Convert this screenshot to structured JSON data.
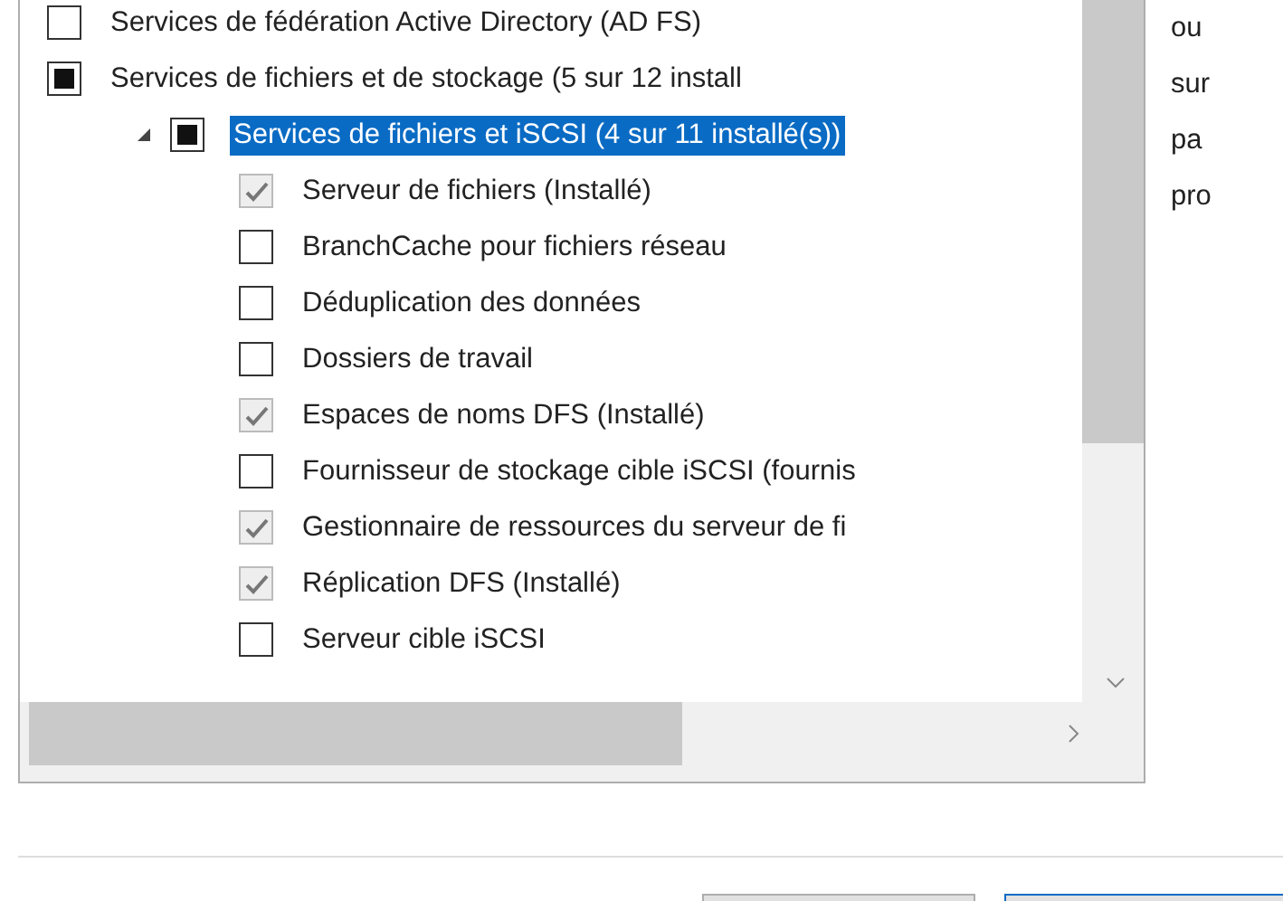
{
  "tree": {
    "items": [
      {
        "label": "Services de fédération Active Directory (AD FS)",
        "checked": false,
        "partial": false,
        "selected": false
      },
      {
        "label": "Services de fichiers et de stockage (5 sur 12 install",
        "checked": false,
        "partial": true,
        "selected": false,
        "children": [
          {
            "label": "Services de fichiers et iSCSI (4 sur 11 installé(s))",
            "checked": false,
            "partial": true,
            "selected": true,
            "expanded": true,
            "children": [
              {
                "label": "Serveur de fichiers (Installé)",
                "checked": true,
                "partial": false,
                "selected": false
              },
              {
                "label": "BranchCache pour fichiers réseau",
                "checked": false,
                "partial": false,
                "selected": false
              },
              {
                "label": "Déduplication des données",
                "checked": false,
                "partial": false,
                "selected": false
              },
              {
                "label": "Dossiers de travail",
                "checked": false,
                "partial": false,
                "selected": false
              },
              {
                "label": "Espaces de noms DFS (Installé)",
                "checked": true,
                "partial": false,
                "selected": false
              },
              {
                "label": "Fournisseur de stockage cible iSCSI (fournis",
                "checked": false,
                "partial": false,
                "selected": false
              },
              {
                "label": "Gestionnaire de ressources du serveur de fi",
                "checked": true,
                "partial": false,
                "selected": false
              },
              {
                "label": "Réplication DFS (Installé)",
                "checked": true,
                "partial": false,
                "selected": false
              },
              {
                "label": "Serveur cible iSCSI",
                "checked": false,
                "partial": false,
                "selected": false
              }
            ]
          }
        ]
      }
    ]
  },
  "description": {
    "lines": [
      "ou",
      "sur",
      "pa",
      "pro"
    ]
  }
}
